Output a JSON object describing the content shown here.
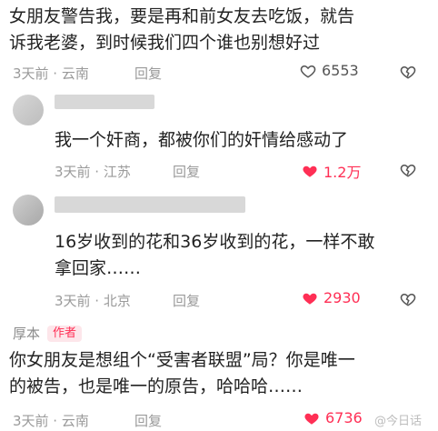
{
  "comments": [
    {
      "text_line1": "女朋友警告我，要是再和前女友去吃饭，就告",
      "text_line2": "诉我老婆，到时候我们四个谁也别想好过",
      "meta": "3天前 · 云南",
      "reply": "回复",
      "likes": "6553",
      "liked": false
    },
    {
      "author": "",
      "text": "我一个奸商，都被你们的奸情给感动了",
      "meta": "3天前 · 江苏",
      "reply": "回复",
      "likes": "1.2万",
      "liked": true
    },
    {
      "author": "",
      "text_line1": "16岁收到的花和36岁收到的花，一样不敢",
      "text_line2": "拿回家……",
      "meta": "3天前 · 北京",
      "reply": "回复",
      "likes": "2930",
      "liked": true
    },
    {
      "author": "厚本",
      "badge": "作者",
      "text_line1": "你女朋友是想组个“受害者联盟”局？你是唯一",
      "text_line2": "的被告，也是唯一的原告，哈哈哈……",
      "meta": "3天前 · 云南",
      "reply": "回复",
      "likes": "6736",
      "liked": true
    }
  ],
  "watermark": "@今日话",
  "colors": {
    "like_red": "#ff2f55",
    "meta_gray": "#9a9a9a",
    "badge_bg": "#fde6ea"
  },
  "icons": {
    "like": "heart-icon",
    "dislike": "broken-heart-icon"
  }
}
